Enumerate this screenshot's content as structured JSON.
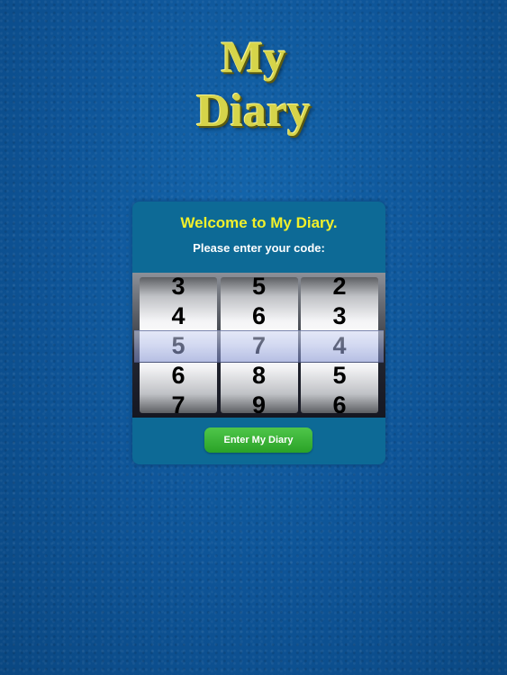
{
  "app": {
    "title_line1": "My",
    "title_line2": "Diary"
  },
  "login": {
    "welcome": "Welcome to My Diary.",
    "prompt": "Please enter your code:",
    "wheels": [
      {
        "digits": [
          "3",
          "4",
          "5",
          "6",
          "7"
        ],
        "selected": "5"
      },
      {
        "digits": [
          "5",
          "6",
          "7",
          "8",
          "9"
        ],
        "selected": "7"
      },
      {
        "digits": [
          "2",
          "3",
          "4",
          "5",
          "6"
        ],
        "selected": "4"
      }
    ],
    "enter_button": "Enter My Diary"
  },
  "colors": {
    "background": "#0e5497",
    "title": "#d6d44a",
    "welcome_text": "#f1f02b",
    "panel": "#0d6a96",
    "button": "#2aa227"
  }
}
